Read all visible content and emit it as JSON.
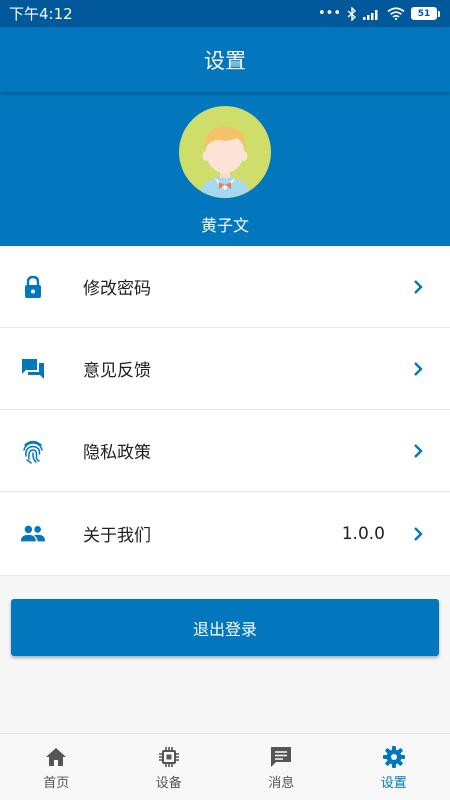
{
  "status_bar": {
    "time": "下午4:12",
    "battery": "51"
  },
  "header": {
    "title": "设置"
  },
  "profile": {
    "name": "黄子文"
  },
  "menu": {
    "items": [
      {
        "label": "修改密码",
        "icon": "lock-icon",
        "value": ""
      },
      {
        "label": "意见反馈",
        "icon": "feedback-icon",
        "value": ""
      },
      {
        "label": "隐私政策",
        "icon": "fingerprint-icon",
        "value": ""
      },
      {
        "label": "关于我们",
        "icon": "people-icon",
        "value": "1.0.0"
      }
    ]
  },
  "logout": {
    "label": "退出登录"
  },
  "tabs": [
    {
      "label": "首页",
      "icon": "home-icon",
      "active": false
    },
    {
      "label": "设备",
      "icon": "chip-icon",
      "active": false
    },
    {
      "label": "消息",
      "icon": "message-icon",
      "active": false
    },
    {
      "label": "设置",
      "icon": "gear-icon",
      "active": true
    }
  ],
  "colors": {
    "primary": "#0277bd",
    "status_bar": "#01589b",
    "active_tab": "#0277bd"
  }
}
